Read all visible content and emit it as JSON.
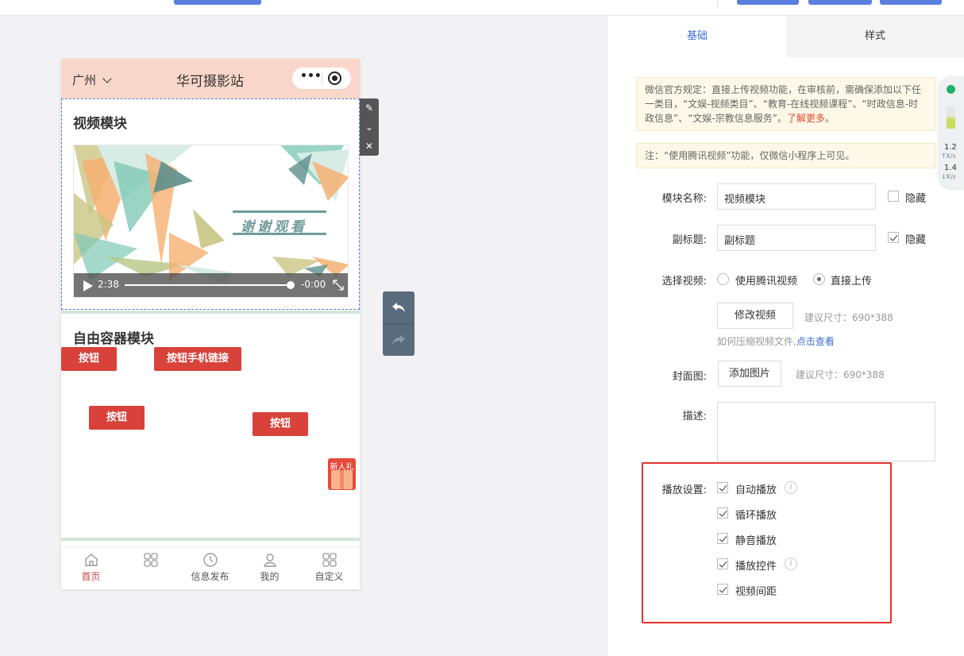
{
  "phone": {
    "city": "广州",
    "title": "华可摄影站",
    "video_module": {
      "title": "视频模块",
      "thanks_text": "谢谢观看",
      "current_time": "2:38",
      "remaining_time": "-0:00"
    },
    "free_module": {
      "title": "自由容器模块",
      "buttons": [
        "按钮",
        "按钮手机链接",
        "按钮",
        "按钮"
      ],
      "gift_label": "新人礼"
    },
    "tabbar": [
      "首页",
      "",
      "信息发布",
      "我的",
      "自定义"
    ]
  },
  "panel": {
    "tabs": [
      "基础",
      "样式"
    ],
    "notice1_text": "微信官方规定：直接上传视频功能，在审核前，需确保添加以下任一类目，“文娱-视频类目”、“教育-在线视频课程”、“时政信息-时政信息”、“文娱-宗教信息服务”。",
    "notice1_link": "了解更多",
    "notice1_end": "。",
    "notice2_text": "注：“使用腾讯视频”功能，仅微信小程序上可见。",
    "module_name_label": "模块名称:",
    "module_name_value": "视频模块",
    "hide_label": "隐藏",
    "subtitle_label": "副标题:",
    "subtitle_value": "副标题",
    "select_video_label": "选择视频:",
    "radio_tencent": "使用腾讯视频",
    "radio_upload": "直接上传",
    "modify_video_btn": "修改视频",
    "size_hint": "建议尺寸：690*388",
    "compress_hint": "如何压缩视频文件,",
    "compress_link": "点击查看",
    "cover_label": "封面图:",
    "add_image_btn": "添加图片",
    "desc_label": "描述:",
    "play_settings_label": "播放设置:",
    "play_options": [
      "自动播放",
      "循环播放",
      "静音播放",
      "播放控件",
      "视频间距"
    ]
  },
  "speed": {
    "up": "1.2",
    "down": "1.4",
    "unit": "K/s"
  },
  "colors": {
    "accent": "#3f6ad8",
    "button_red": "#d9413b",
    "highlight": "#e3302b",
    "header_pink": "#f8d6ca"
  }
}
